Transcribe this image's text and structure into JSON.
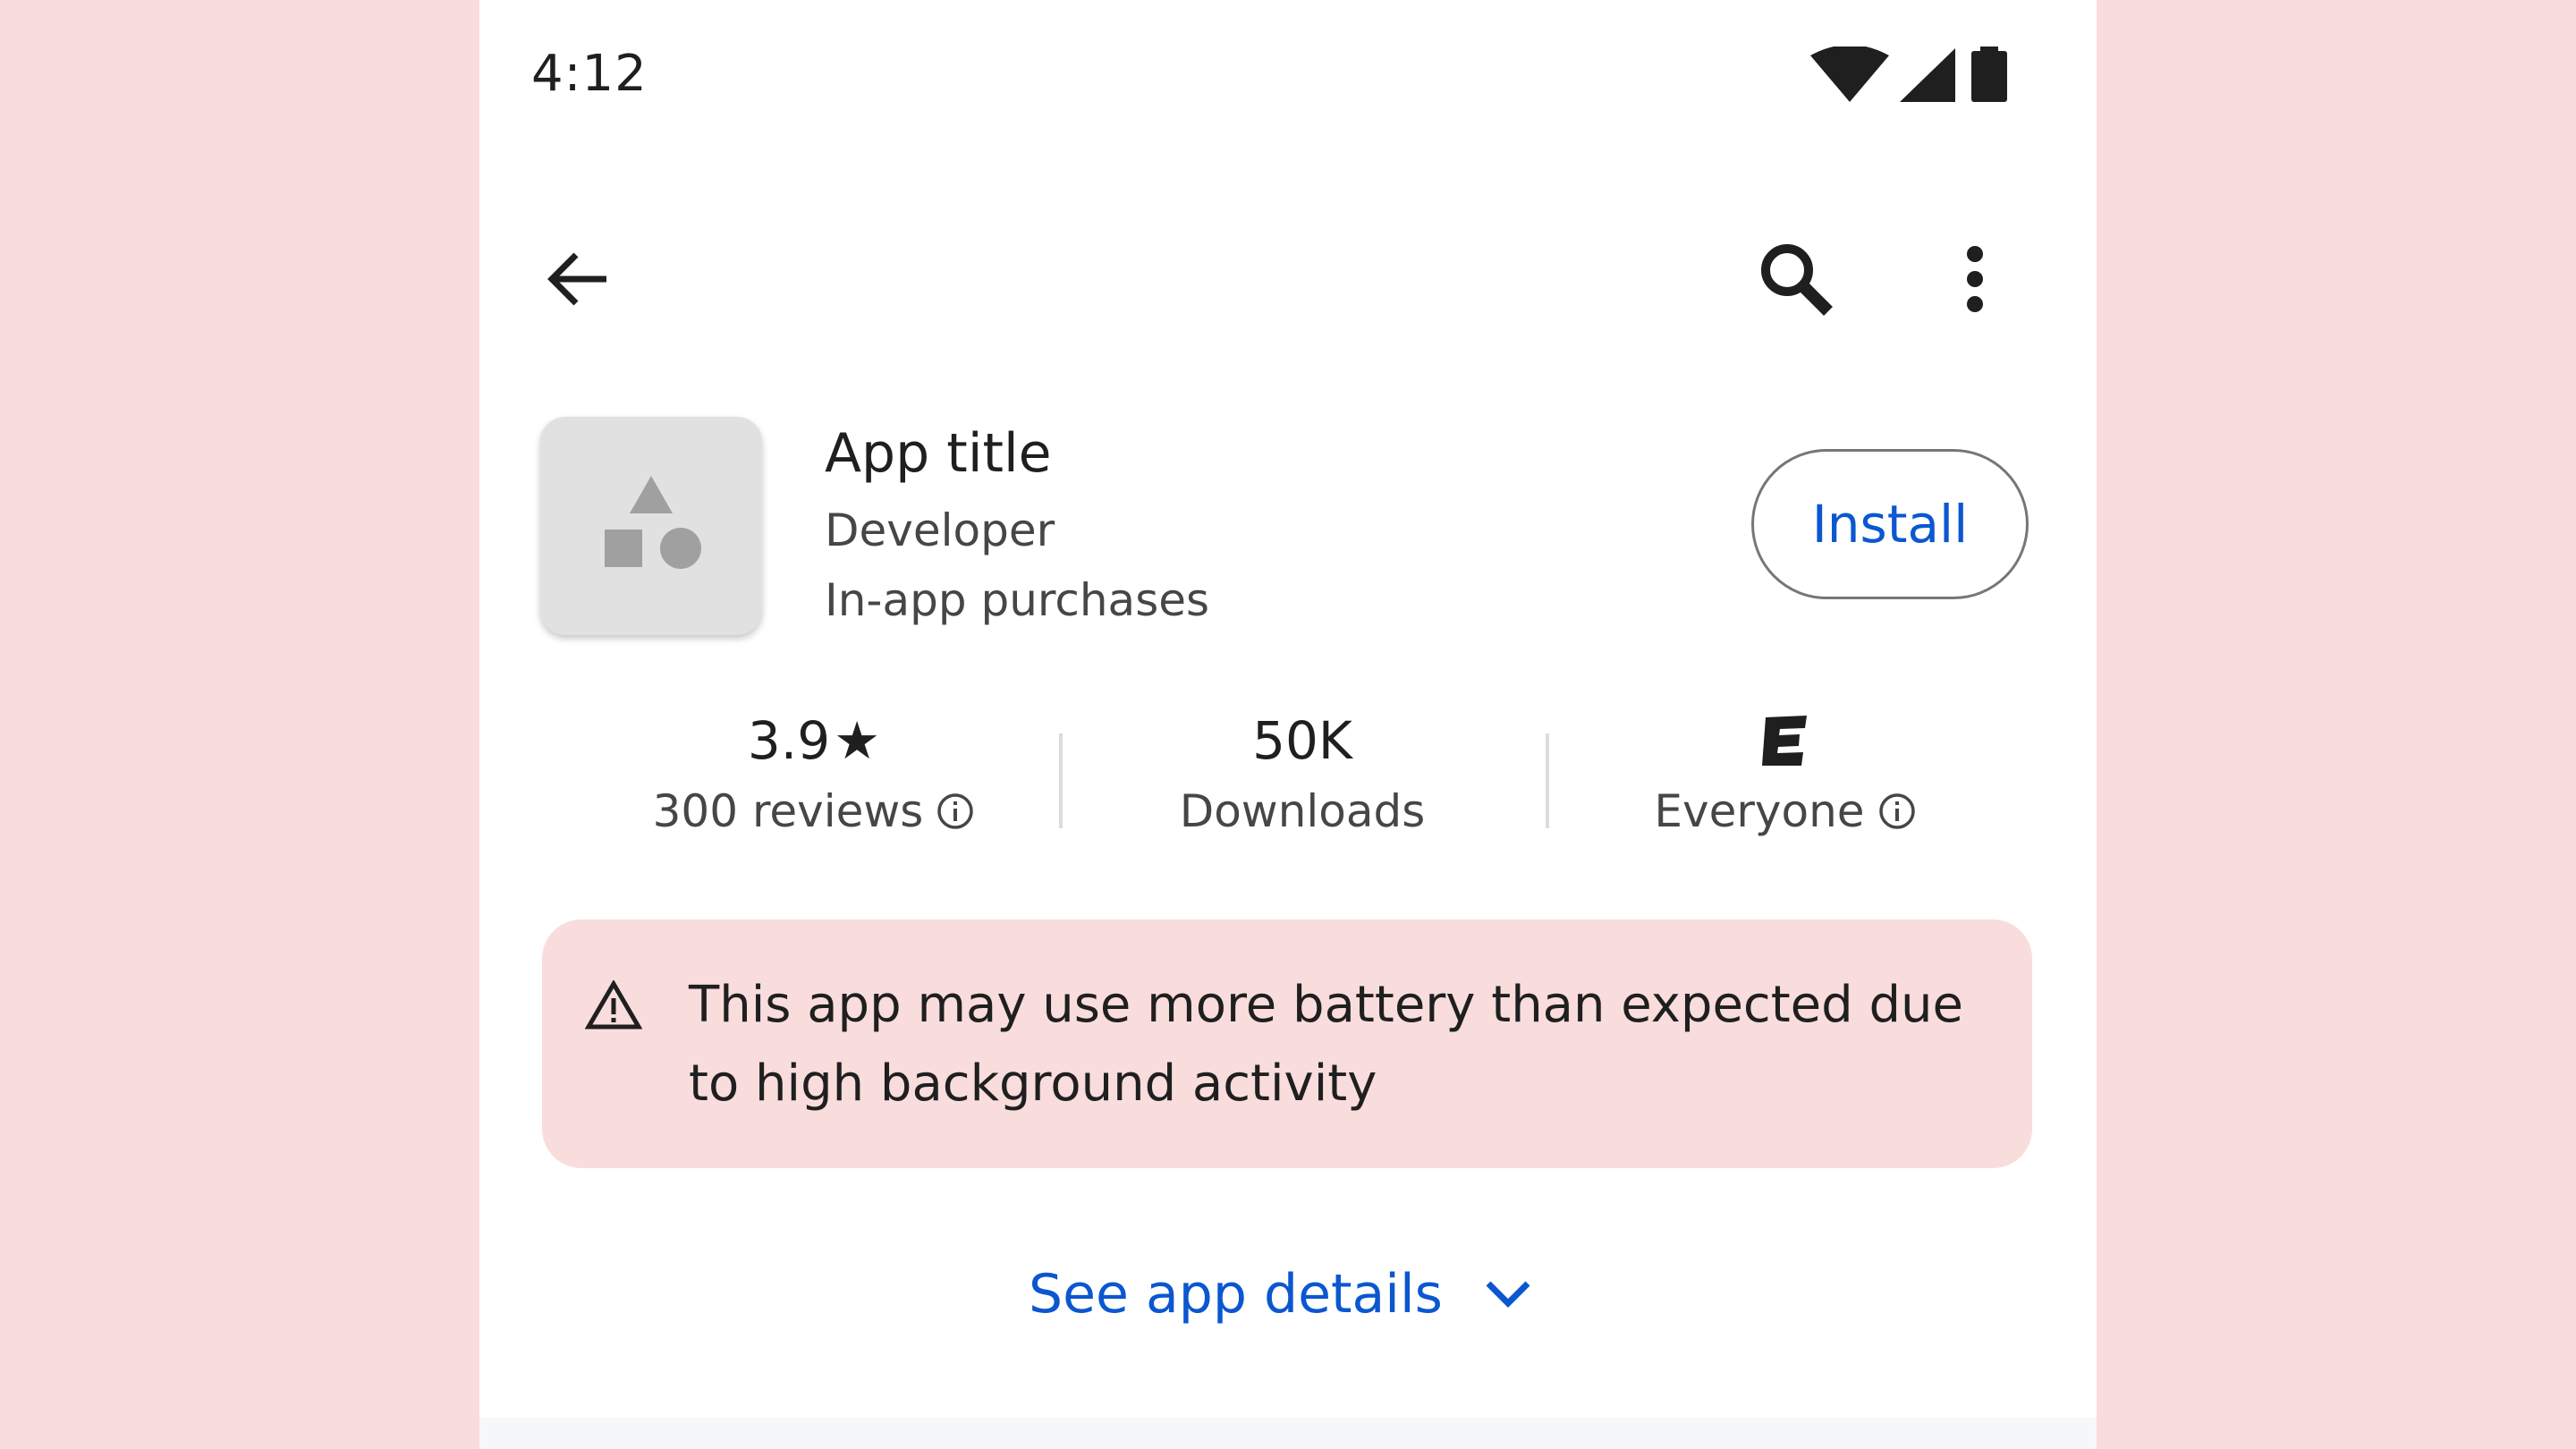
{
  "status_bar": {
    "time": "4:12",
    "icons": [
      "wifi-icon",
      "cell-signal-icon",
      "battery-icon"
    ]
  },
  "app_bar": {
    "back_icon": "arrow-back-icon",
    "search_icon": "search-icon",
    "more_icon": "more-vert-icon"
  },
  "app": {
    "title": "App title",
    "developer": "Developer",
    "purchases": "In-app purchases",
    "install_label": "Install"
  },
  "stats": {
    "rating_value": "3.9",
    "rating_star": "★",
    "reviews": "300 reviews",
    "downloads_value": "50K",
    "downloads_label": "Downloads",
    "content_rating_badge": "E",
    "content_rating_label": "Everyone"
  },
  "warning": {
    "icon": "warning-icon",
    "text": "This app may use more battery than expected due to high background activity"
  },
  "details": {
    "link_label": "See app details"
  },
  "colors": {
    "page_background": "#f9dcdc",
    "accent_blue": "#0b57d0",
    "warning_background": "#f9dcdc",
    "icon_placeholder": "#e1e1e1"
  }
}
